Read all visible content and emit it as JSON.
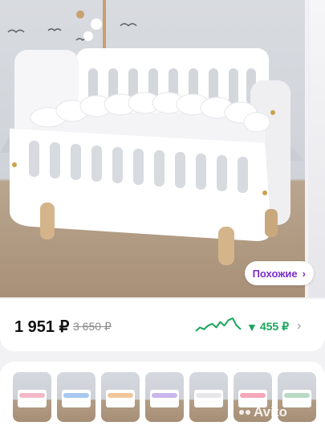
{
  "product": {
    "price": "1 951 ₽",
    "old_price": "3 650 ₽",
    "price_drop": "455 ₽",
    "price_trend": [
      3,
      5,
      4,
      6,
      7,
      5,
      8,
      6,
      9,
      10,
      6,
      4
    ],
    "colors": {
      "accent": "#7a2fd0",
      "drop": "#1aa65a"
    }
  },
  "photo": {
    "similar_label": "Похожие",
    "similar_icon": "chevron-right-icon"
  },
  "thumbnails": [
    {
      "band_color": "#f3b8c8"
    },
    {
      "band_color": "#a8c8ef"
    },
    {
      "band_color": "#f1c79a"
    },
    {
      "band_color": "#c9b6ea"
    },
    {
      "band_color": "#e7e7ea"
    },
    {
      "band_color": "#f4a7b9"
    },
    {
      "band_color": "#b8d9c3"
    }
  ],
  "watermark": {
    "text": "Avito"
  }
}
